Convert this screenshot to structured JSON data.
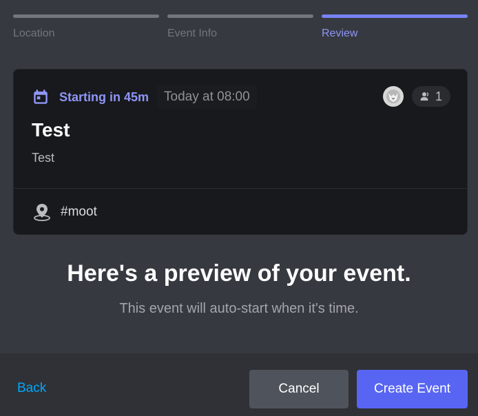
{
  "steps": [
    {
      "label": "Location",
      "active": false
    },
    {
      "label": "Event Info",
      "active": false
    },
    {
      "label": "Review",
      "active": true
    }
  ],
  "card": {
    "status": "Starting in 45m",
    "time": "Today at 08:00",
    "interested_count": "1",
    "title": "Test",
    "description": "Test",
    "location": "#moot",
    "icons": {
      "status": "calendar-icon",
      "interested": "person-icon",
      "location": "location-pin-icon"
    }
  },
  "preview": {
    "headline": "Here's a preview of your event.",
    "subline": "This event will auto-start when it's time."
  },
  "footer": {
    "back_label": "Back",
    "cancel_label": "Cancel",
    "create_label": "Create Event"
  },
  "colors": {
    "accent": "#5865f2",
    "link": "#00a8fc",
    "background": "#36393f"
  }
}
